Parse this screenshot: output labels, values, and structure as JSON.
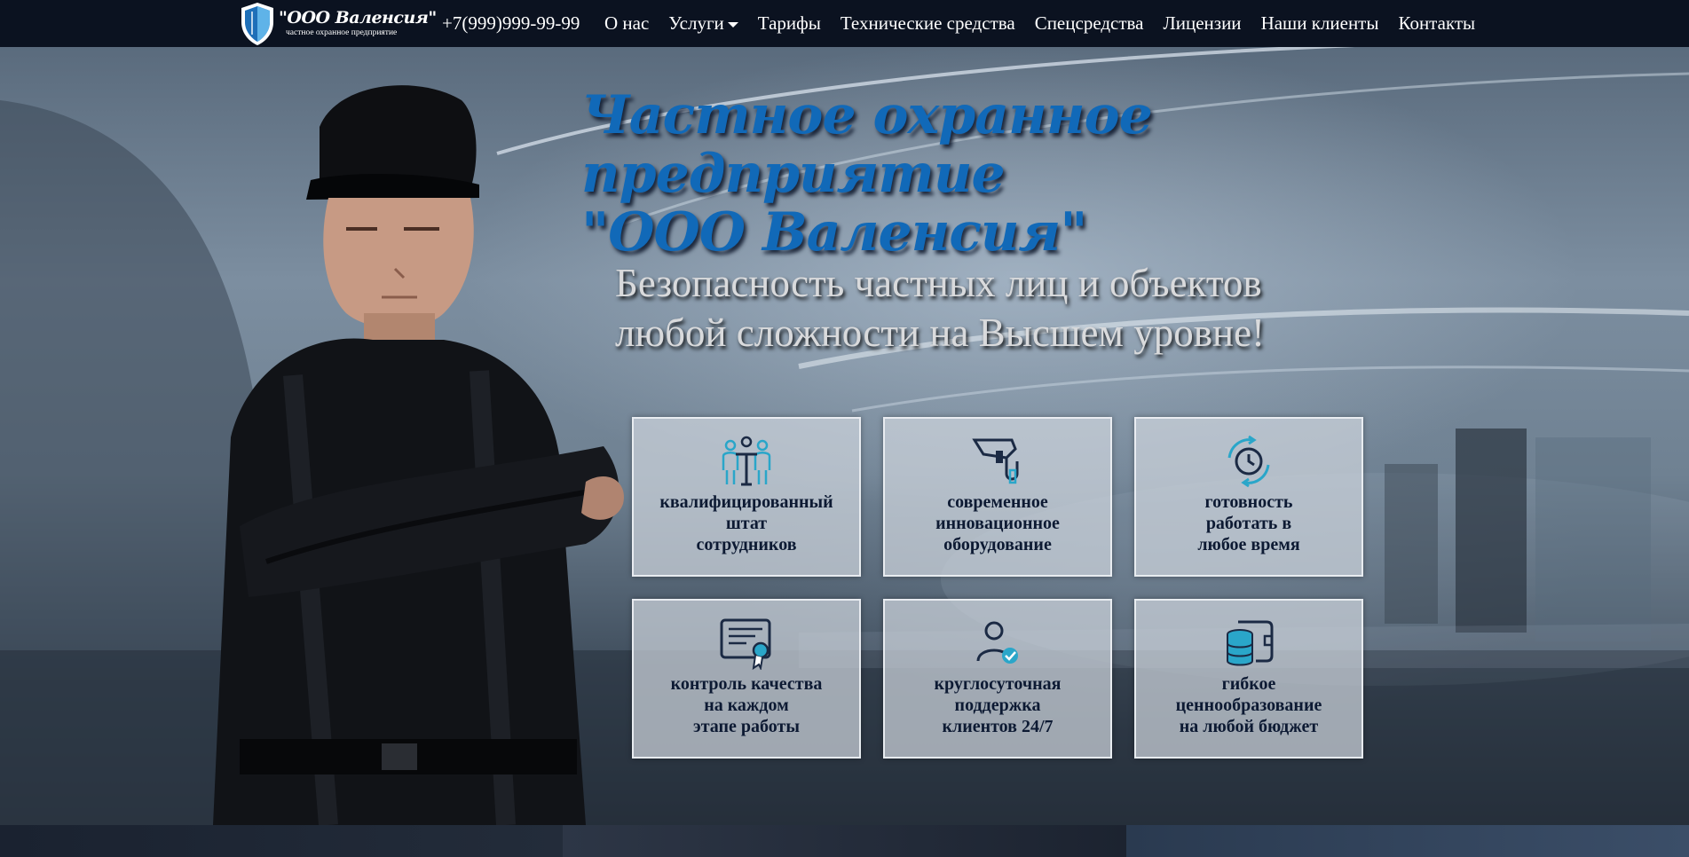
{
  "nav": {
    "brand_name": "\"ООО Валенсия\"",
    "brand_sub": "частное охранное предприятие",
    "phone": "+7(999)999-99-99",
    "items": [
      {
        "label": "О нас"
      },
      {
        "label": "Услуги",
        "dropdown": true
      },
      {
        "label": "Тарифы"
      },
      {
        "label": "Технические средства"
      },
      {
        "label": "Спецсредства"
      },
      {
        "label": "Лицензии"
      },
      {
        "label": "Наши клиенты"
      },
      {
        "label": "Контакты"
      }
    ]
  },
  "hero": {
    "headline_line1": "Частное охранное предприятие",
    "headline_line2": "\"ООО Валенсия\"",
    "tagline_line1": "Безопасность частных лиц и объектов",
    "tagline_line2": "любой сложности на Высшем уровне!"
  },
  "features": [
    {
      "icon": "staff-icon",
      "text": "квалифицированный\nштат\nсотрудников"
    },
    {
      "icon": "cctv-camera-icon",
      "text": "современное\nинновационное\nоборудование"
    },
    {
      "icon": "clock-refresh-icon",
      "text": "готовность\nработать в\nлюбое время"
    },
    {
      "icon": "certificate-icon",
      "text": "контроль качества\nна каждом\nэтапе работы"
    },
    {
      "icon": "user-check-icon",
      "text": "круглосуточная\nподдержка\nклиентов 24/7"
    },
    {
      "icon": "wallet-coins-icon",
      "text": "гибкое\nценнообразование\nна любой бюджет"
    }
  ],
  "colors": {
    "navbar_bg": "#0b1220",
    "headline": "#1169b8",
    "card_text": "#0d1a33",
    "icon_accent": "#2aa6c9"
  }
}
